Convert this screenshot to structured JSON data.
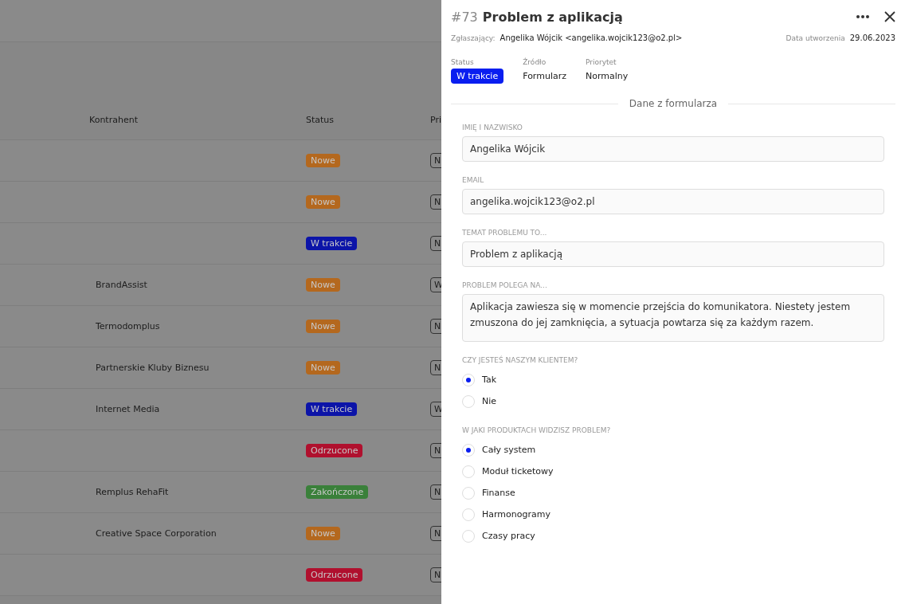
{
  "table": {
    "columns": [
      "Kontrahent",
      "Status",
      "Pri"
    ],
    "rows": [
      {
        "contractor": "",
        "status": "Nowe",
        "color": "#b4681e",
        "priority": "N"
      },
      {
        "contractor": "",
        "status": "Nowe",
        "color": "#b4681e",
        "priority": "N"
      },
      {
        "contractor": "",
        "status": "W trakcie",
        "color": "#0c14a8",
        "priority": "N"
      },
      {
        "contractor": "BrandAssist",
        "status": "Nowe",
        "color": "#b4681e",
        "priority": "W"
      },
      {
        "contractor": "Termodomplus",
        "status": "Nowe",
        "color": "#b4681e",
        "priority": "N"
      },
      {
        "contractor": "Partnerskie Kluby Biznesu",
        "status": "Nowe",
        "color": "#b4681e",
        "priority": "N"
      },
      {
        "contractor": "Internet Media",
        "status": "W trakcie",
        "color": "#0c14a8",
        "priority": "W"
      },
      {
        "contractor": "",
        "status": "Odrzucone",
        "color": "#b0102e",
        "priority": "N"
      },
      {
        "contractor": "Remplus RehaFit",
        "status": "Zakończone",
        "color": "#3a803a",
        "priority": "N"
      },
      {
        "contractor": "Creative Space Corporation",
        "status": "Nowe",
        "color": "#b4681e",
        "priority": "N"
      },
      {
        "contractor": "",
        "status": "Odrzucone",
        "color": "#b0102e",
        "priority": "N"
      }
    ]
  },
  "drawer": {
    "number": "#73",
    "title": "Problem z aplikacją",
    "reporter_label": "Zgłaszający:",
    "reporter": "Angelika Wójcik <angelika.wojcik123@o2.pl>",
    "created_label": "Data utworzenia",
    "created": "29.06.2023",
    "meta": [
      {
        "label": "Status",
        "value": "W trakcie",
        "kind": "badge",
        "color": "#0a1ef0"
      },
      {
        "label": "Źródło",
        "value": "Formularz",
        "kind": "text"
      },
      {
        "label": "Priorytet",
        "value": "Normalny",
        "kind": "text"
      }
    ],
    "section_title": "Dane z formularza",
    "fields": [
      {
        "label": "IMIĘ I NAZWISKO",
        "kind": "input",
        "value": "Angelika Wójcik"
      },
      {
        "label": "EMAIL",
        "kind": "input",
        "value": "angelika.wojcik123@o2.pl"
      },
      {
        "label": "TEMAT PROBLEMU TO...",
        "kind": "input",
        "value": "Problem z aplikacją"
      },
      {
        "label": "PROBLEM POLEGA NA...",
        "kind": "textarea",
        "value": "Aplikacja zawiesza się w momencie przejścia do komunikatora. Niestety jestem zmuszona do jej zamknięcia, a sytuacja powtarza się za każdym razem."
      },
      {
        "label": "CZY JESTEŚ NASZYM KLIENTEM?",
        "kind": "radio",
        "options": [
          {
            "label": "Tak",
            "selected": true
          },
          {
            "label": "Nie",
            "selected": false
          }
        ]
      },
      {
        "label": "W JAKI PRODUKTACH WIDZISZ PROBLEM?",
        "kind": "radio",
        "options": [
          {
            "label": "Cały system",
            "selected": true
          },
          {
            "label": "Moduł ticketowy",
            "selected": false
          },
          {
            "label": "Finanse",
            "selected": false
          },
          {
            "label": "Harmonogramy",
            "selected": false
          },
          {
            "label": "Czasy pracy",
            "selected": false
          }
        ]
      }
    ]
  }
}
